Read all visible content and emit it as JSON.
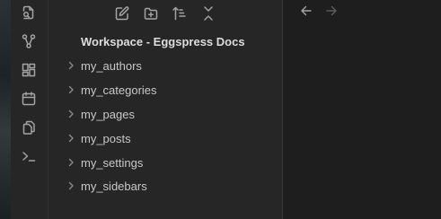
{
  "ribbon": {
    "items": [
      {
        "icon": "open-quick-switcher-icon"
      },
      {
        "icon": "graph-view-icon"
      },
      {
        "icon": "canvas-icon"
      },
      {
        "icon": "daily-note-calendar-icon"
      },
      {
        "icon": "templates-copy-icon"
      },
      {
        "icon": "terminal-prompt-icon"
      }
    ]
  },
  "file_explorer": {
    "actions": [
      {
        "icon": "new-note-icon"
      },
      {
        "icon": "new-folder-icon"
      },
      {
        "icon": "sort-icon"
      },
      {
        "icon": "collapse-all-icon"
      }
    ],
    "vault_name": "Workspace - Eggspress Docs",
    "folders": [
      {
        "label": "my_authors"
      },
      {
        "label": "my_categories"
      },
      {
        "label": "my_pages"
      },
      {
        "label": "my_posts"
      },
      {
        "label": "my_settings"
      },
      {
        "label": "my_sidebars"
      }
    ]
  },
  "main": {
    "history": [
      {
        "icon": "navigate-back-icon",
        "enabled": true
      },
      {
        "icon": "navigate-forward-icon",
        "enabled": false
      }
    ]
  },
  "colors": {
    "icon": "#a3a3a3",
    "icon_disabled": "#5c5c5c",
    "sidebar_bg": "#262626",
    "main_bg": "#1e1e1e"
  }
}
